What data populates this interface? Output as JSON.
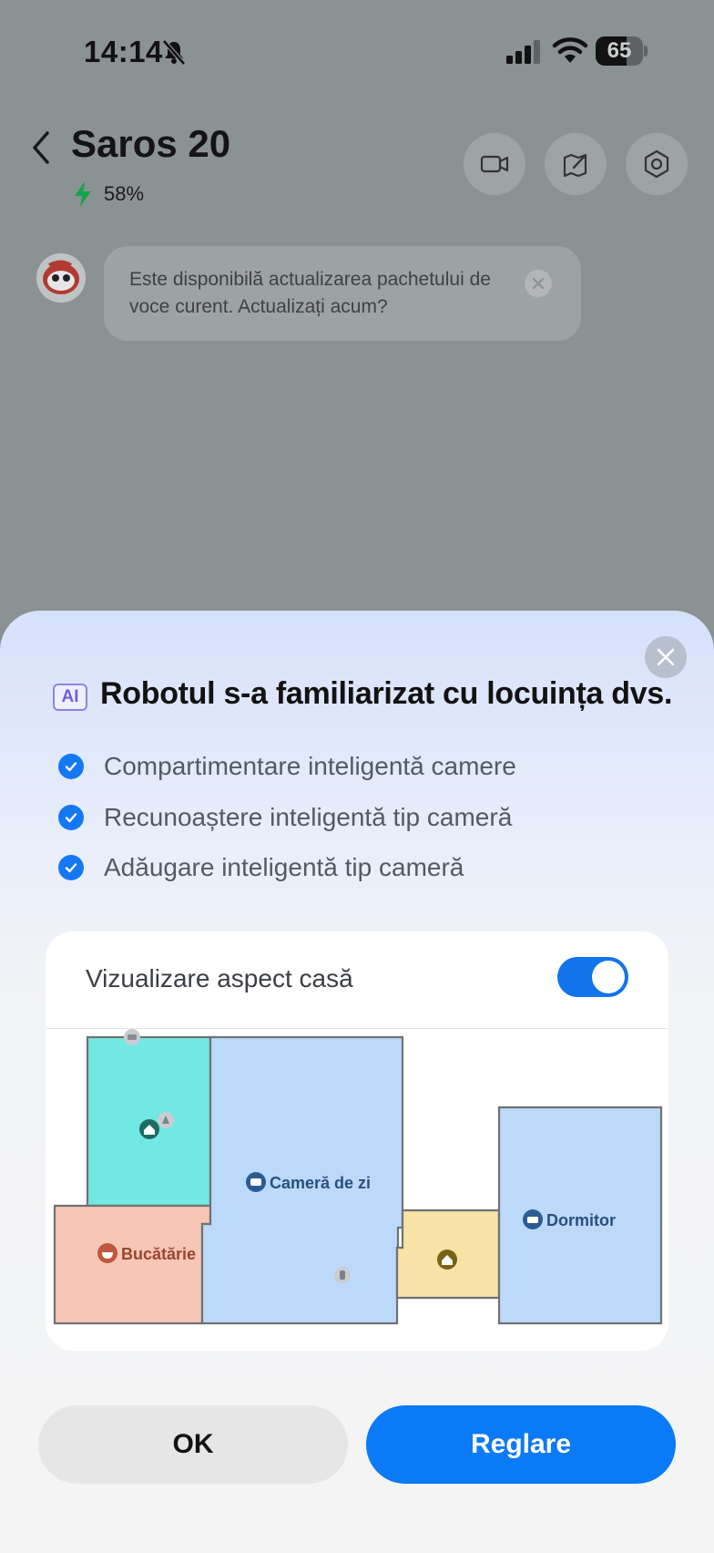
{
  "status_bar": {
    "time": "14:14",
    "battery_percent": "65",
    "battery_level": 0.65,
    "icons": [
      "bell-muted-icon",
      "cellular-signal-icon",
      "wifi-icon",
      "battery-icon"
    ]
  },
  "header": {
    "device_name": "Saros 20",
    "battery_label": "58%",
    "actions": [
      "video-camera-icon",
      "edit-map-icon",
      "settings-icon"
    ]
  },
  "notification": {
    "message": "Este disponibilă actualizarea pachetului de voce curent. Actualizați acum?"
  },
  "sheet": {
    "badge": "AI",
    "title": "Robotul s-a familiarizat cu locuința dvs.",
    "features": [
      "Compartimentare inteligentă camere",
      "Recunoaștere inteligentă tip cameră",
      "Adăugare inteligentă tip cameră"
    ],
    "layout_card": {
      "title": "Vizualizare aspect casă",
      "toggle_on": true,
      "rooms": [
        {
          "name": "",
          "color": "#72e8e2",
          "icon": "home-icon"
        },
        {
          "name": "Bucătărie",
          "color": "#f7c6b6",
          "icon": "kitchen-icon"
        },
        {
          "name": "Cameră de zi",
          "color": "#bcd9fa",
          "icon": "sofa-icon"
        },
        {
          "name": "",
          "color": "#f6e3a5",
          "icon": "home-icon"
        },
        {
          "name": "Dormitor",
          "color": "#bcd9fa",
          "icon": "bed-icon"
        }
      ]
    },
    "buttons": {
      "ok": "OK",
      "adjust": "Reglare"
    }
  },
  "colors": {
    "accent": "#0a7af6",
    "check": "#1578f3",
    "charging": "#1aa34a"
  }
}
